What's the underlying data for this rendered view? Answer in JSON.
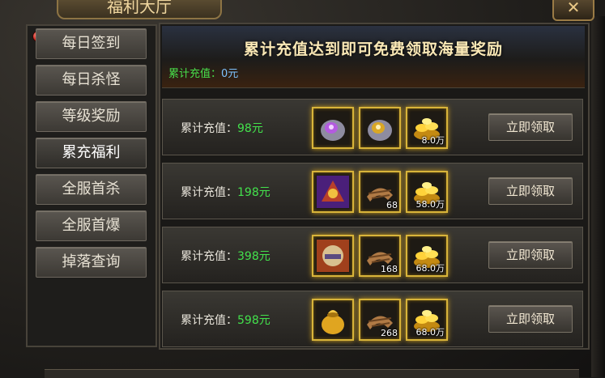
{
  "window": {
    "title": "福利大厅",
    "close_label": "✕"
  },
  "menu": [
    {
      "label": "每日签到"
    },
    {
      "label": "每日杀怪"
    },
    {
      "label": "等级奖励"
    },
    {
      "label": "累充福利"
    },
    {
      "label": "全服首杀"
    },
    {
      "label": "全服首爆"
    },
    {
      "label": "掉落查询"
    }
  ],
  "banner": {
    "title": "累计充值达到即可免费领取海量奖励",
    "recharge_label": "累计充值：",
    "recharge_amount": "0元"
  },
  "rows": [
    {
      "label": "累计充值：",
      "amount": "98元",
      "items": [
        {
          "icon": "purple-gem-ore-icon",
          "qty": ""
        },
        {
          "icon": "gold-gem-ore-icon",
          "qty": ""
        },
        {
          "icon": "gold-ingot-pile-icon",
          "qty": "8.0万"
        }
      ],
      "button": "立即领取"
    },
    {
      "label": "累计充值：",
      "amount": "198元",
      "items": [
        {
          "icon": "purple-armor-icon",
          "qty": ""
        },
        {
          "icon": "scroll-bundle-icon",
          "qty": "68"
        },
        {
          "icon": "gold-ingot-pile-icon",
          "qty": "58.0万"
        }
      ],
      "button": "立即领取"
    },
    {
      "label": "累计充值：",
      "amount": "398元",
      "items": [
        {
          "icon": "helmet-item-icon",
          "qty": ""
        },
        {
          "icon": "scroll-bundle-icon",
          "qty": "168"
        },
        {
          "icon": "gold-ingot-pile-icon",
          "qty": "68.0万"
        }
      ],
      "button": "立即领取"
    },
    {
      "label": "累计充值：",
      "amount": "598元",
      "items": [
        {
          "icon": "gold-pouch-icon",
          "qty": ""
        },
        {
          "icon": "scroll-bundle-icon",
          "qty": "268"
        },
        {
          "icon": "gold-ingot-pile-icon",
          "qty": "68.0万"
        }
      ],
      "button": "立即领取"
    }
  ]
}
